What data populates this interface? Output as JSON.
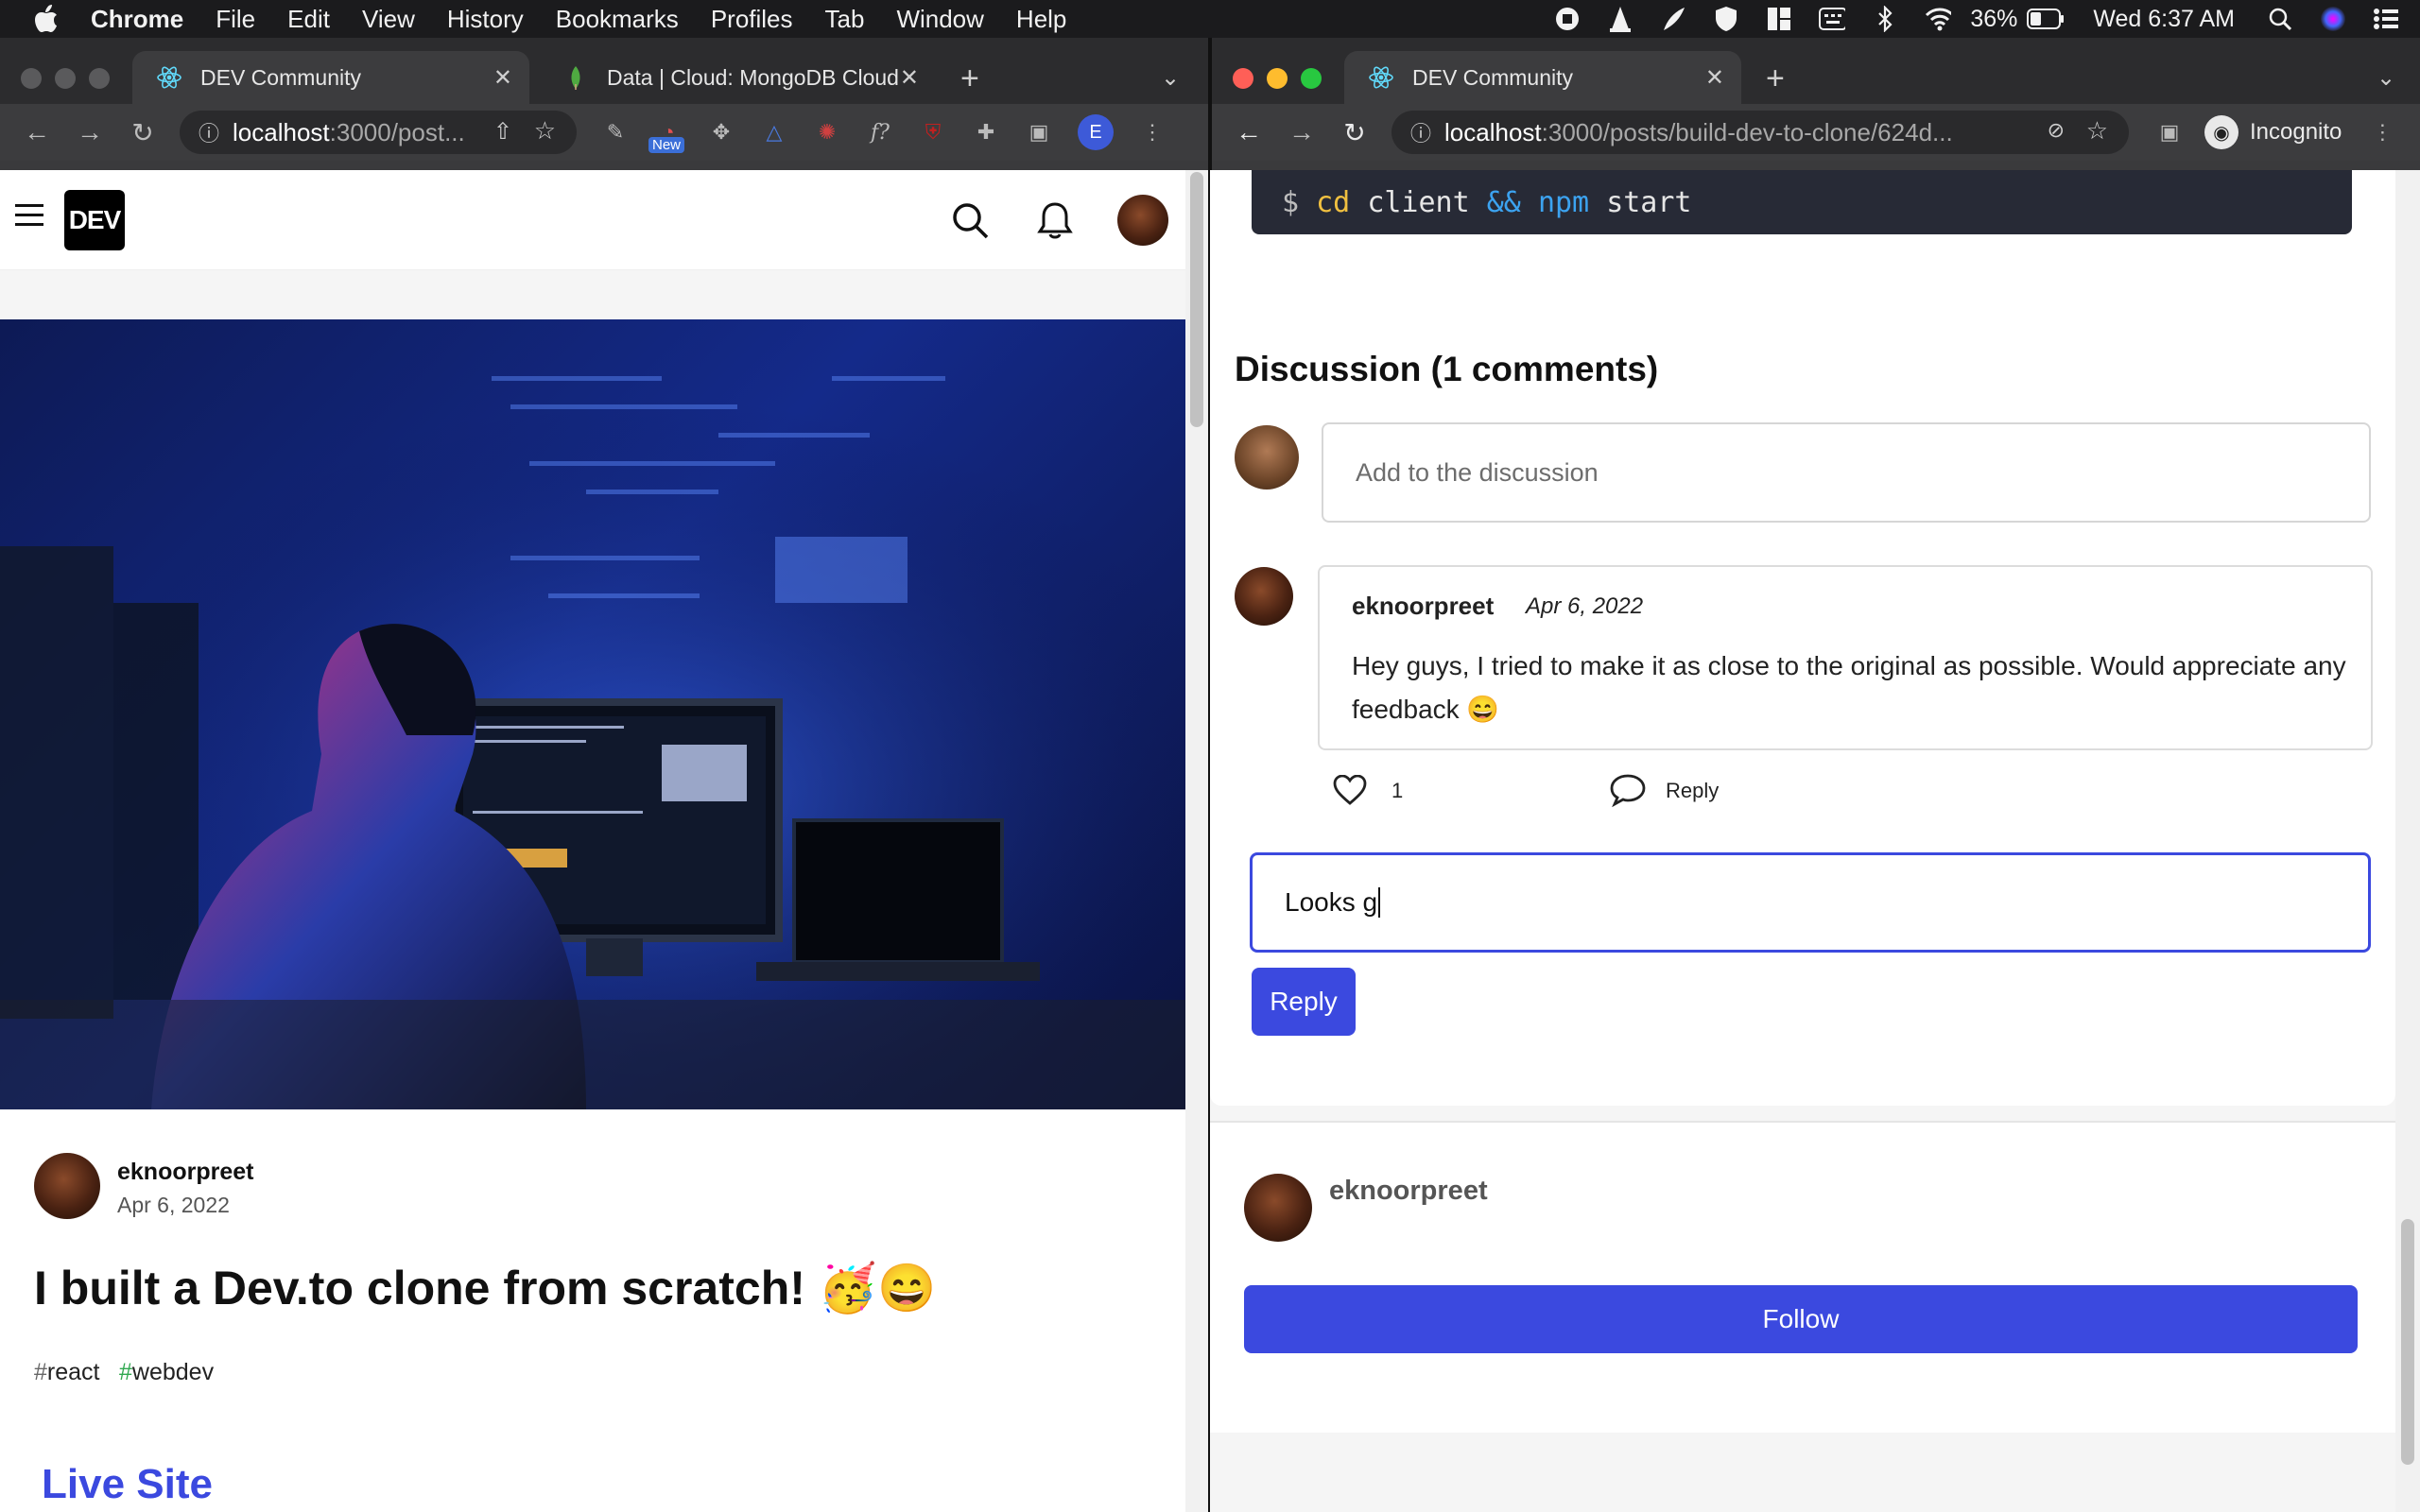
{
  "menubar": {
    "app": "Chrome",
    "items": [
      "File",
      "Edit",
      "View",
      "History",
      "Bookmarks",
      "Profiles",
      "Tab",
      "Window",
      "Help"
    ],
    "battery": "36%",
    "clock": "Wed 6:37 AM"
  },
  "left_window": {
    "tabs": [
      {
        "title": "DEV Community"
      },
      {
        "title": "Data | Cloud: MongoDB Cloud"
      }
    ],
    "url_host": "localhost",
    "url_path": ":3000/post...",
    "ext_badge": "New",
    "profile_letter": "E",
    "page": {
      "author": "eknoorpreet",
      "date": "Apr 6, 2022",
      "title": "I built a Dev.to clone from scratch! 🥳😄",
      "tags": [
        "react",
        "webdev"
      ],
      "live_site": "Live Site"
    }
  },
  "right_window": {
    "tab_title": "DEV Community",
    "url_host": "localhost",
    "url_path": ":3000/posts/build-dev-to-clone/624d...",
    "incognito_label": "Incognito",
    "code_line": {
      "prompt": "$",
      "cmd1": "cd",
      "arg1": "client",
      "op": "&&",
      "cmd2": "npm",
      "arg2": "start"
    },
    "discussion": {
      "heading": "Discussion (1 comments)",
      "input_placeholder": "Add to the discussion",
      "comment": {
        "author": "eknoorpreet",
        "date": "Apr 6, 2022",
        "text": "Hey guys, I tried to make it as close to the original as possible. Would appreciate any feedback 😄",
        "likes": "1",
        "reply_label": "Reply"
      },
      "reply_value": "Looks g",
      "reply_button": "Reply"
    },
    "author_card": {
      "name": "eknoorpreet",
      "follow_label": "Follow"
    }
  },
  "colors": {
    "accent": "#3b49df",
    "dev_black": "#000000",
    "hash_green": "#2fa84f",
    "hash_gray": "#666666"
  }
}
